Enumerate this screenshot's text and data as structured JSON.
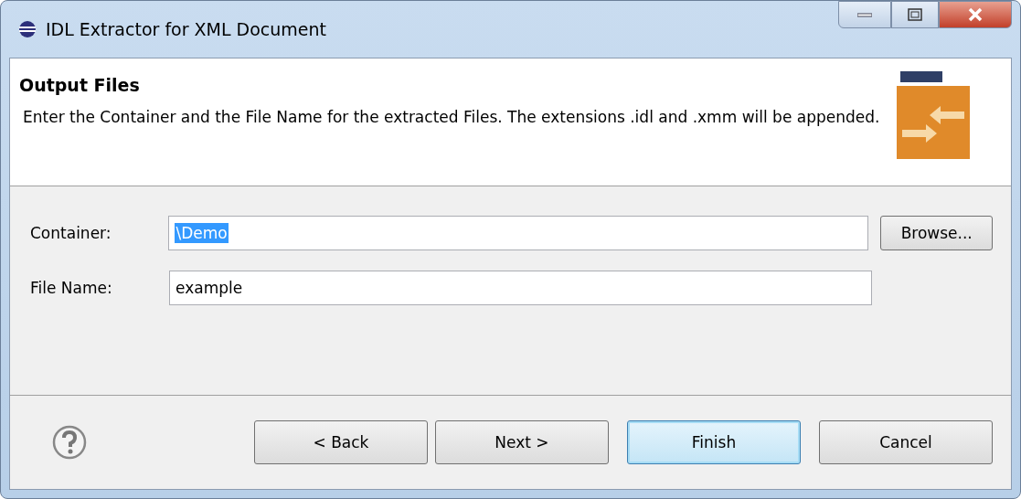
{
  "window": {
    "title": "IDL Extractor for XML Document"
  },
  "header": {
    "title": "Output Files",
    "description": "Enter the Container and the File Name for the extracted Files. The extensions .idl and .xmm will be appended."
  },
  "fields": [
    {
      "label": "Container:",
      "value": "\\Demo",
      "value_selected": true,
      "button": "Browse..."
    },
    {
      "label": "File Name:",
      "value": "example",
      "value_selected": false
    }
  ],
  "buttons": [
    {
      "label": "< Back",
      "default": false
    },
    {
      "label": "Next >",
      "default": false
    },
    {
      "label": "Finish",
      "default": true
    },
    {
      "label": "Cancel",
      "default": false
    }
  ]
}
